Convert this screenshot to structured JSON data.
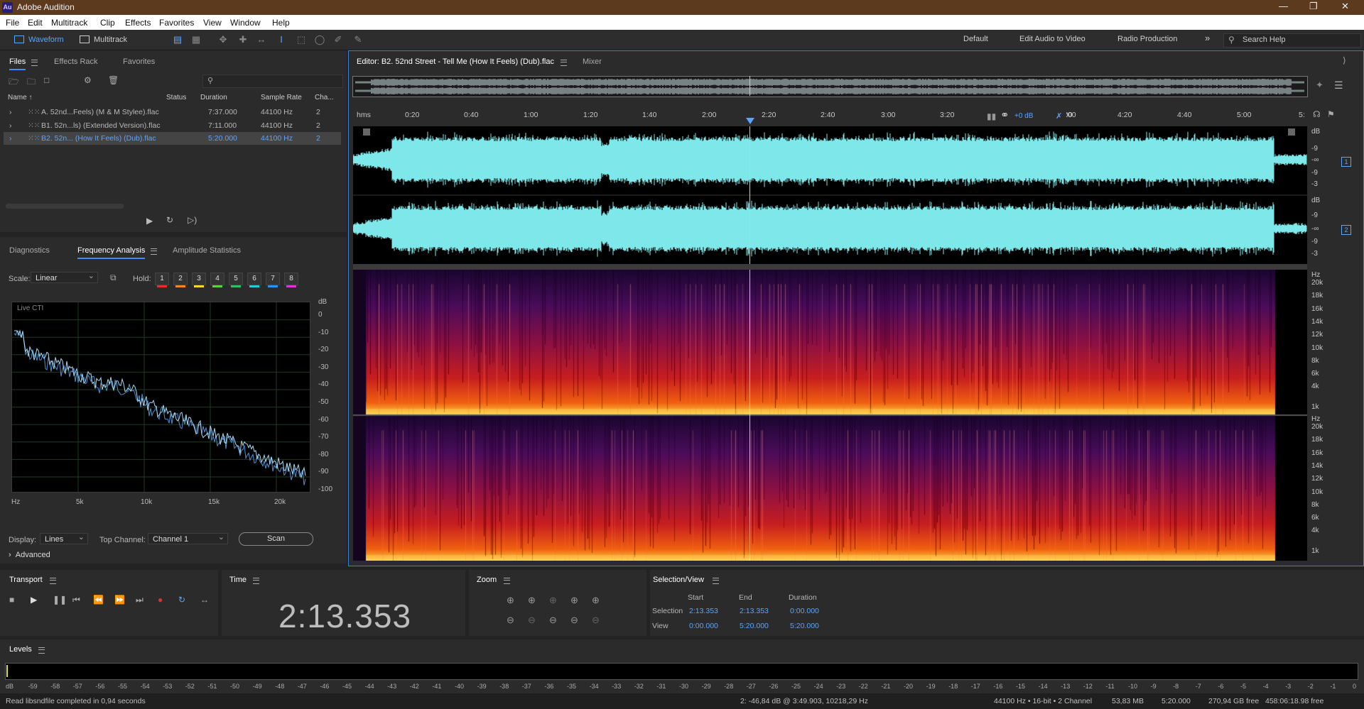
{
  "app": {
    "title": "Adobe Audition",
    "logo": "Au"
  },
  "menu": [
    "File",
    "Edit",
    "Multitrack",
    "Clip",
    "Effects",
    "Favorites",
    "View",
    "Window",
    "Help"
  ],
  "toolbar": {
    "waveform": "Waveform",
    "multitrack": "Multitrack",
    "workspaces": [
      "Default",
      "Edit Audio to Video",
      "Radio Production"
    ],
    "overflow": "»",
    "search_placeholder": "Search Help"
  },
  "files_panel": {
    "tabs": [
      "Files",
      "Effects Rack",
      "Favorites"
    ],
    "columns": [
      "Name",
      "Status",
      "Duration",
      "Sample Rate",
      "Cha..."
    ],
    "rows": [
      {
        "name": "A. 52nd...Feels) (M & M Stylee).flac",
        "status": "",
        "duration": "7:37.000",
        "rate": "44100 Hz",
        "ch": "2"
      },
      {
        "name": "B1. 52n...ls) (Extended Version).flac",
        "status": "",
        "duration": "7:11.000",
        "rate": "44100 Hz",
        "ch": "2"
      },
      {
        "name": "B2. 52n... (How It Feels) (Dub).flac",
        "status": "",
        "duration": "5:20.000",
        "rate": "44100 Hz",
        "ch": "2"
      }
    ]
  },
  "analysis": {
    "tabs": [
      "Diagnostics",
      "Frequency Analysis",
      "Amplitude Statistics"
    ],
    "scale_label": "Scale:",
    "scale_value": "Linear",
    "hold_label": "Hold:",
    "hold": [
      {
        "n": "1",
        "color": "#e03030"
      },
      {
        "n": "2",
        "color": "#f08a20"
      },
      {
        "n": "3",
        "color": "#f0e020"
      },
      {
        "n": "4",
        "color": "#60d040"
      },
      {
        "n": "5",
        "color": "#30c060"
      },
      {
        "n": "6",
        "color": "#20d0d0"
      },
      {
        "n": "7",
        "color": "#3090f0"
      },
      {
        "n": "8",
        "color": "#e030e0"
      }
    ],
    "graph_label": "Live CTI",
    "db_unit": "dB",
    "db_ticks": [
      "0",
      "-10",
      "-20",
      "-30",
      "-40",
      "-50",
      "-60",
      "-70",
      "-80",
      "-90",
      "-100"
    ],
    "freq_ticks": [
      "Hz",
      "5k",
      "10k",
      "15k",
      "20k"
    ],
    "display_label": "Display:",
    "display_value": "Lines",
    "top_channel_label": "Top Channel:",
    "top_channel_value": "Channel 1",
    "scan": "Scan",
    "advanced": "Advanced"
  },
  "editor": {
    "tab": "Editor: B2. 52nd Street - Tell Me (How It Feels) (Dub).flac",
    "mixer": "Mixer",
    "ruler_unit": "hms",
    "ruler": [
      "0:20",
      "0:40",
      "1:00",
      "1:20",
      "1:40",
      "2:00",
      "2:20",
      "2:40",
      "3:00",
      "3:20",
      "",
      "4:00",
      "4:20",
      "4:40",
      "5:00",
      "5:"
    ],
    "ruler_partial": ":00",
    "volume": "+0 dB",
    "db_unit": "dB",
    "wave_db": [
      "-9",
      "-∞",
      "-9",
      "-3"
    ],
    "wave_db_top": "dB",
    "channels": [
      "1",
      "2"
    ],
    "spec_unit": "Hz",
    "spec_ticks": [
      "20k",
      "18k",
      "16k",
      "14k",
      "12k",
      "10k",
      "8k",
      "6k",
      "4k",
      "1k"
    ]
  },
  "transport": {
    "title": "Transport"
  },
  "time": {
    "title": "Time",
    "value": "2:13.353"
  },
  "zoom": {
    "title": "Zoom"
  },
  "selection": {
    "title": "Selection/View",
    "headers": [
      "Start",
      "End",
      "Duration"
    ],
    "rows": [
      {
        "label": "Selection",
        "start": "2:13.353",
        "end": "2:13.353",
        "duration": "0:00.000"
      },
      {
        "label": "View",
        "start": "0:00.000",
        "end": "5:20.000",
        "duration": "5:20.000"
      }
    ]
  },
  "levels": {
    "title": "Levels",
    "ticks": [
      "dB",
      "-59",
      "-58",
      "-57",
      "-56",
      "-55",
      "-54",
      "-53",
      "-52",
      "-51",
      "-50",
      "-49",
      "-48",
      "-47",
      "-46",
      "-45",
      "-44",
      "-43",
      "-42",
      "-41",
      "-40",
      "-39",
      "-38",
      "-37",
      "-36",
      "-35",
      "-34",
      "-33",
      "-32",
      "-31",
      "-30",
      "-29",
      "-28",
      "-27",
      "-26",
      "-25",
      "-24",
      "-23",
      "-22",
      "-21",
      "-20",
      "-19",
      "-18",
      "-17",
      "-16",
      "-15",
      "-14",
      "-13",
      "-12",
      "-11",
      "-10",
      "-9",
      "-8",
      "-7",
      "-6",
      "-5",
      "-4",
      "-3",
      "-2",
      "-1",
      "0"
    ]
  },
  "status": {
    "left": "Read libsndfile completed in 0,94 seconds",
    "cursor": "2: -46,84 dB @ 3:49.903, 10218,29 Hz",
    "format": "44100 Hz • 16-bit • 2 Channel",
    "size": "53,83 MB",
    "duration": "5:20.000",
    "free": "270,94 GB free",
    "free_time": "458:06:18.98 free"
  },
  "colors": {
    "accent": "#3d8bff",
    "waveform": "#7ee7e9",
    "playhead": "#e5e020"
  }
}
